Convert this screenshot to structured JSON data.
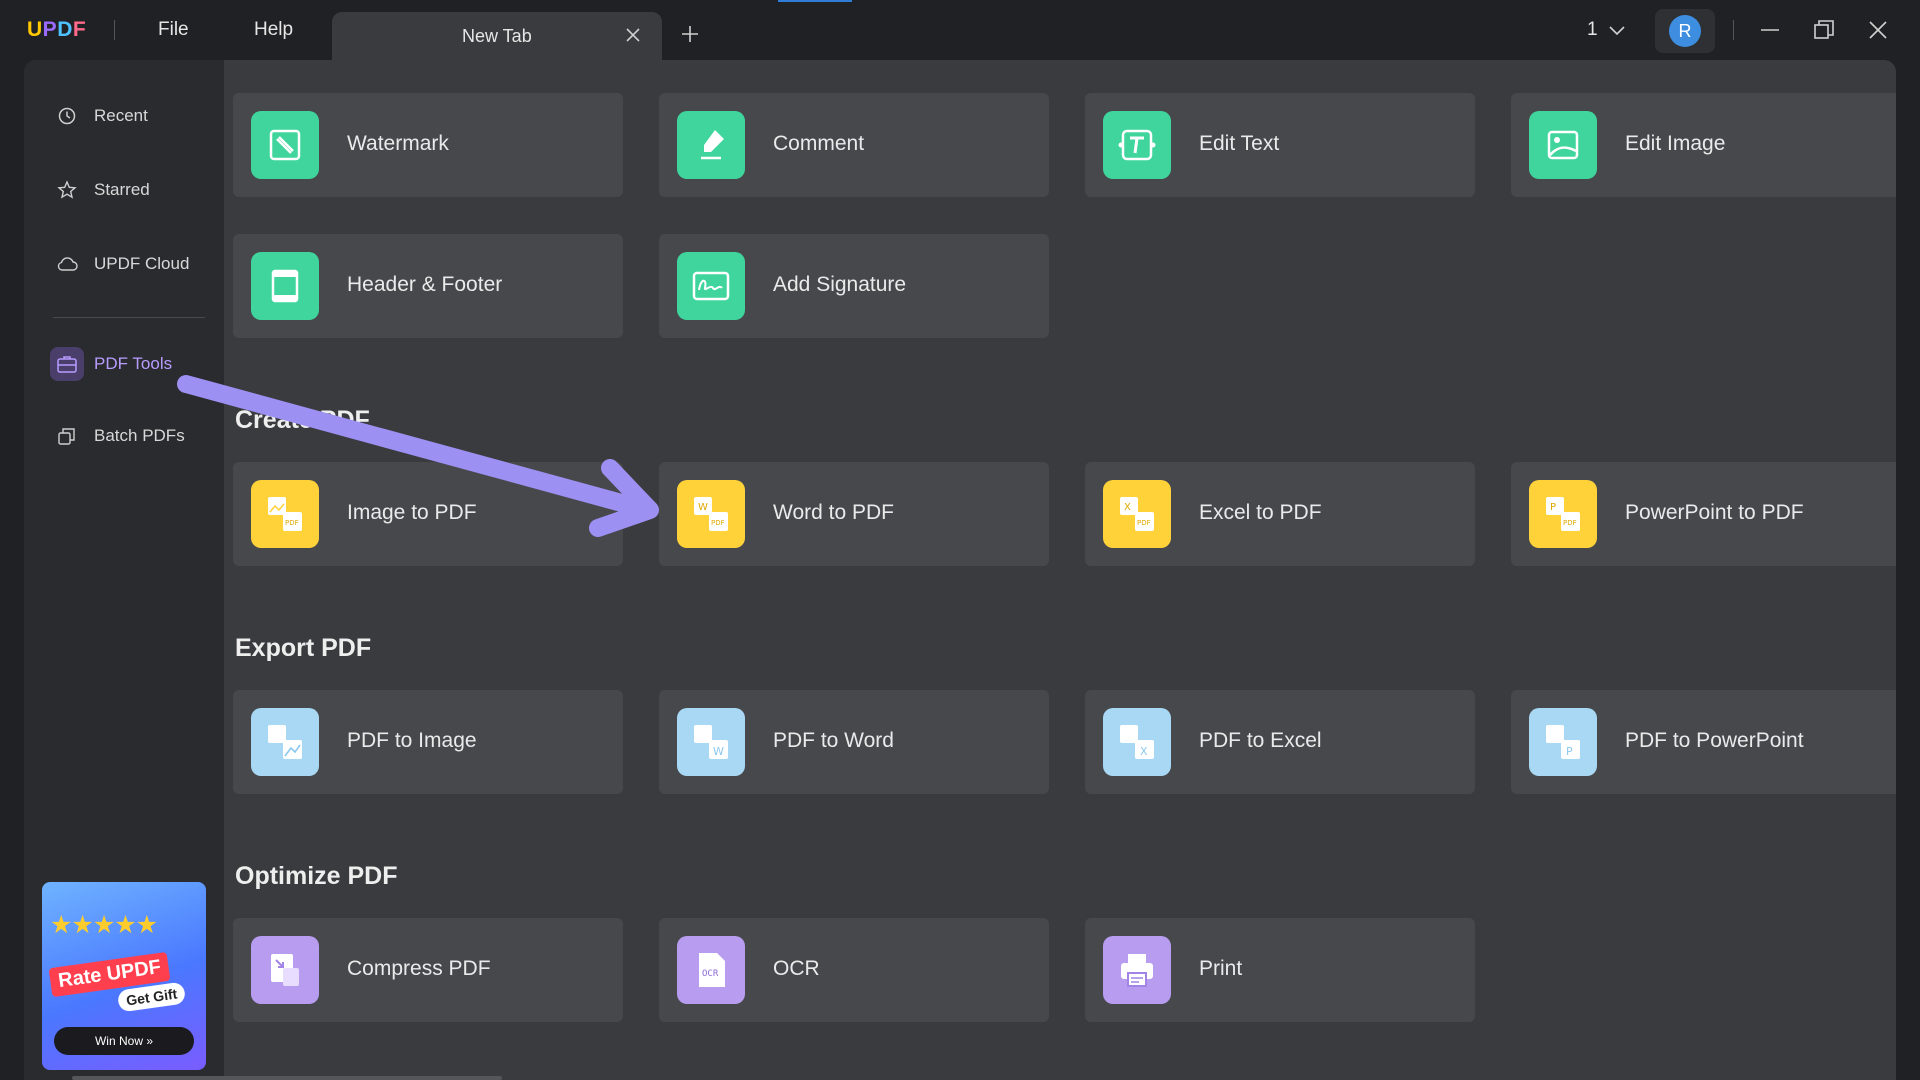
{
  "app": {
    "logo": "UPDF"
  },
  "menu": {
    "file": "File",
    "help": "Help"
  },
  "tab": {
    "label": "New Tab"
  },
  "header": {
    "page": "1",
    "avatar_initial": "R"
  },
  "sidebar": {
    "items": [
      {
        "label": "Recent",
        "icon": "clock-icon"
      },
      {
        "label": "Starred",
        "icon": "star-icon"
      },
      {
        "label": "UPDF Cloud",
        "icon": "cloud-icon"
      },
      {
        "label": "PDF Tools",
        "icon": "toolbox-icon",
        "active": true
      },
      {
        "label": "Batch PDFs",
        "icon": "batch-icon"
      }
    ]
  },
  "promo": {
    "title": "Rate UPDF",
    "gift": "Get Gift",
    "button": "Win Now »"
  },
  "sections": {
    "create_title": "Create PDF",
    "export_title": "Export PDF",
    "optimize_title": "Optimize PDF"
  },
  "tools": {
    "edit": [
      "Watermark",
      "Comment",
      "Edit Text",
      "Edit Image",
      "Header & Footer",
      "Add Signature"
    ],
    "create": [
      "Image to PDF",
      "Word to PDF",
      "Excel to PDF",
      "PowerPoint to PDF"
    ],
    "export": [
      "PDF to Image",
      "PDF to Word",
      "PDF to Excel",
      "PDF to PowerPoint"
    ],
    "optimize": [
      "Compress PDF",
      "OCR",
      "Print"
    ]
  },
  "colors": {
    "edit": "#3fd59d",
    "create": "#ffd23a",
    "export": "#a9d8f5",
    "optimize": "#b79cf0",
    "accent": "#9b7cff",
    "annotation_arrow": "#9c90f2"
  }
}
